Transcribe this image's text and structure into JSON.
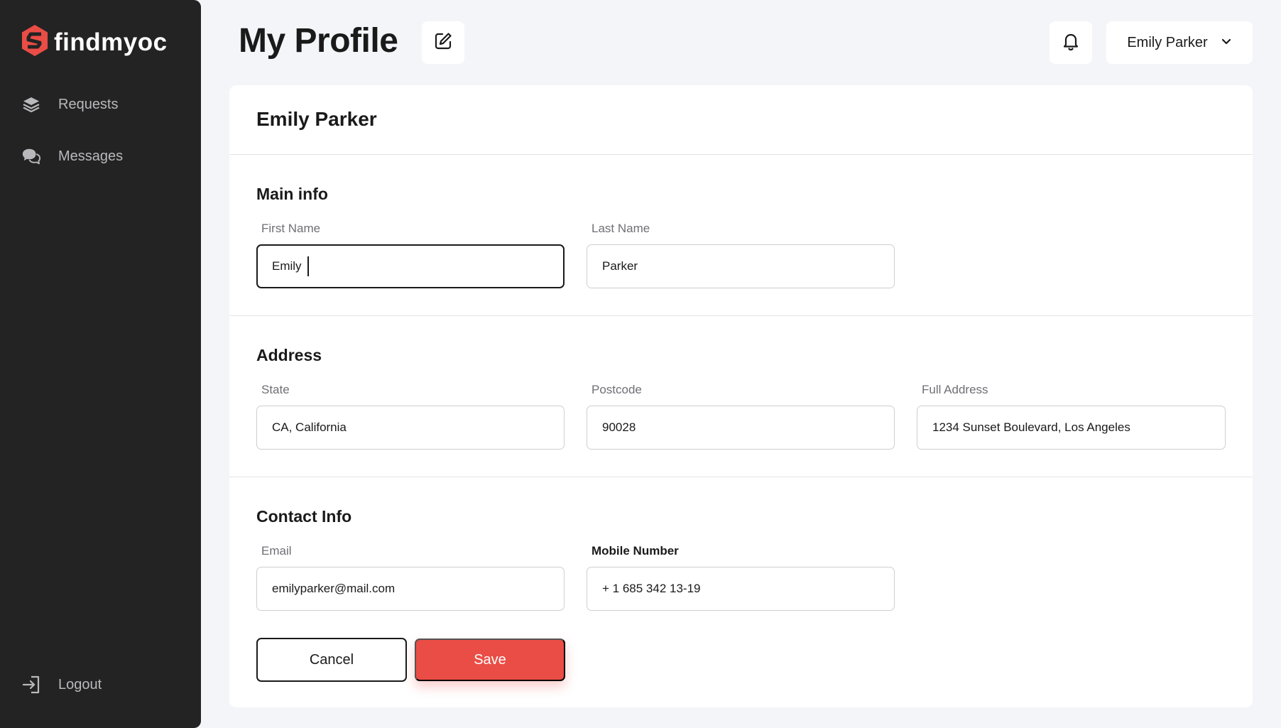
{
  "app": {
    "brand": "findmyoc",
    "accent_color": "#ea4d45"
  },
  "sidebar": {
    "items": [
      {
        "label": "Requests",
        "icon": "layers-icon"
      },
      {
        "label": "Messages",
        "icon": "chat-bubbles-icon"
      }
    ],
    "logout_label": "Logout"
  },
  "header": {
    "title": "My Profile",
    "user_name": "Emily Parker"
  },
  "profile": {
    "name": "Emily Parker",
    "main_info": {
      "title": "Main info",
      "first_name_label": "First Name",
      "first_name_value": "Emily",
      "last_name_label": "Last Name",
      "last_name_value": "Parker"
    },
    "address": {
      "title": "Address",
      "state_label": "State",
      "state_value": "CA, California",
      "postcode_label": "Postcode",
      "postcode_value": "90028",
      "full_address_label": "Full Address",
      "full_address_value": "1234 Sunset Boulevard, Los Angeles"
    },
    "contact": {
      "title": "Contact Info",
      "email_label": "Email",
      "email_value": "emilyparker@mail.com",
      "mobile_label": "Mobile Number",
      "mobile_value": "+ 1 685 342 13-19"
    }
  },
  "actions": {
    "cancel_label": "Cancel",
    "save_label": "Save"
  }
}
